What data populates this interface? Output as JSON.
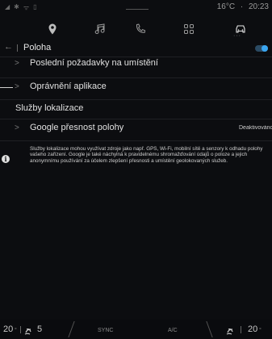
{
  "status": {
    "temperature": "16°C",
    "time": "20:23"
  },
  "nav": {
    "icons": [
      "location-icon",
      "music-icon",
      "phone-icon",
      "apps-icon",
      "car-icon"
    ],
    "active": "car-icon",
    "accent": "#3aa5f0"
  },
  "header": {
    "title": "Poloha",
    "toggle_on": true
  },
  "list": {
    "recent_requests": "Poslední požadavky na umístění",
    "app_permissions": "Oprávnění aplikace"
  },
  "location_services": {
    "section_title": "Služby lokalizace",
    "google_accuracy_label": "Google přesnost polohy",
    "google_accuracy_value": "Deaktivováno"
  },
  "info": {
    "text": "Služby lokalizace mohou využívat zdroje jako např. GPS, Wi-Fi, mobilní sítě a senzory k odhadu polohy vašeho zařízení. Google je také náchylná k pravidelnému shromažďování údajů o poloze a jejich anonymnímu používání za účelem zlepšení přesnosti a umístění geolokovaných služeb."
  },
  "climate": {
    "left_temp": "20",
    "fan_speed": "5",
    "sync_label": "SYNC",
    "ac_label": "A/C",
    "right_temp": "20"
  }
}
